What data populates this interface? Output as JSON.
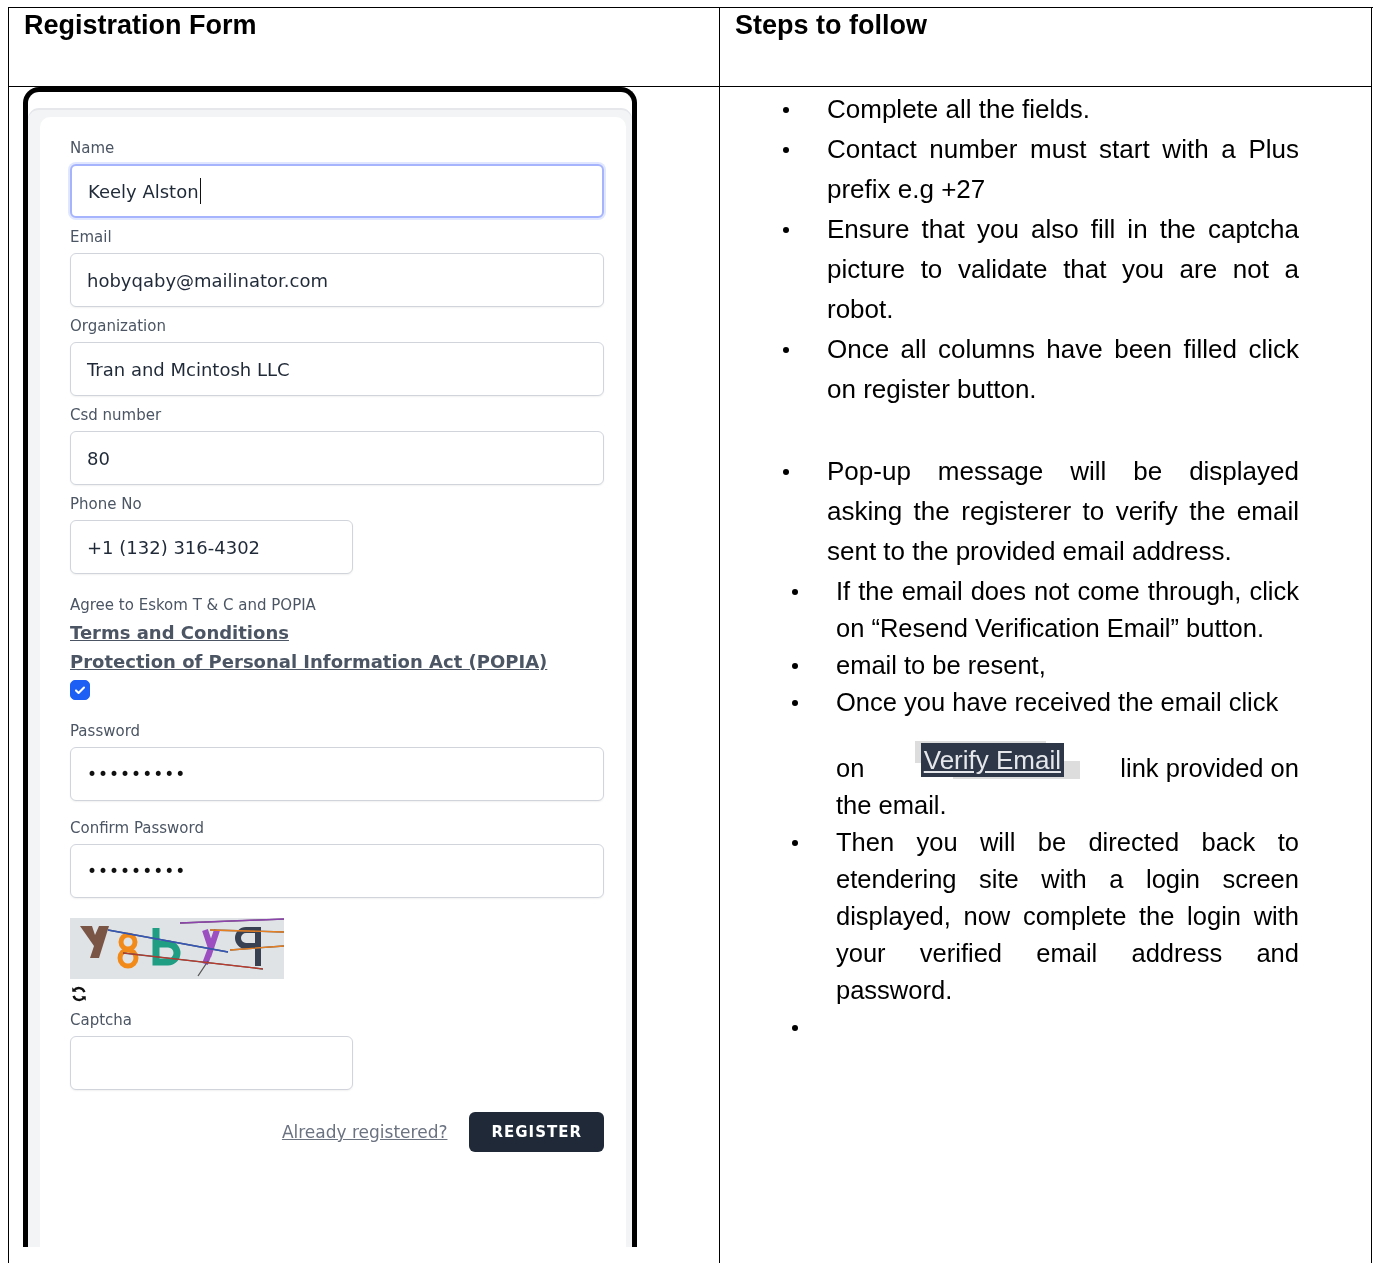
{
  "table": {
    "headers": [
      "Registration Form",
      "Steps to follow"
    ]
  },
  "form": {
    "fields": [
      {
        "label": "Name",
        "value": "Keely Alston",
        "focused": true,
        "short": false
      },
      {
        "label": "Email",
        "value": "hobyqaby@mailinator.com",
        "focused": false,
        "short": false
      },
      {
        "label": "Organization",
        "value": "Tran and Mcintosh LLC",
        "focused": false,
        "short": false
      },
      {
        "label": "Csd number",
        "value": "80",
        "focused": false,
        "short": false
      },
      {
        "label": "Phone No",
        "value": "+1 (132) 316-4302",
        "focused": false,
        "short": true
      }
    ],
    "agreement": {
      "label": "Agree to Eskom T & C and POPIA",
      "links": [
        "Terms and Conditions",
        "Protection of Personal Information Act (POPIA)"
      ],
      "checked": true
    },
    "passwords": [
      {
        "label": "Password",
        "value": "•••••••••",
        "focused": false,
        "short": false
      },
      {
        "label": "Confirm Password",
        "value": "•••••••••",
        "focused": false,
        "short": false
      }
    ],
    "captcha": {
      "label": "Captcha"
    },
    "login_link": "Already registered?",
    "submit": "REGISTER"
  },
  "step_groups": [
    {
      "items": [
        {
          "kind": "text",
          "text": "Complete all the fields."
        },
        {
          "kind": "text",
          "text": "Contact number must start with a Plus prefix e.g +27"
        },
        {
          "kind": "text",
          "text": "Ensure that you also fill in the captcha picture to validate that you are not a robot."
        },
        {
          "kind": "text",
          "text": "Once all columns have been filled click on register button."
        }
      ]
    },
    {
      "items": [
        {
          "kind": "text",
          "text": "Pop-up message will be displayed asking the registerer to verify the email sent to the provided email address."
        }
      ]
    },
    {
      "items": [
        {
          "kind": "text",
          "text": "If the email does not come through, click on “Resend Verification Email” button."
        },
        {
          "kind": "text",
          "text": "email to be resent,"
        },
        {
          "kind": "inline_link",
          "before": "Once you have received the email click",
          "on": "on",
          "link": "Verify Email",
          "after": "link provided on",
          "end": "the email."
        },
        {
          "kind": "text",
          "text": "Then you will be directed back to etendering site with a login screen displayed, now complete the login with your verified email address and password."
        },
        {
          "kind": "blank"
        }
      ]
    }
  ]
}
